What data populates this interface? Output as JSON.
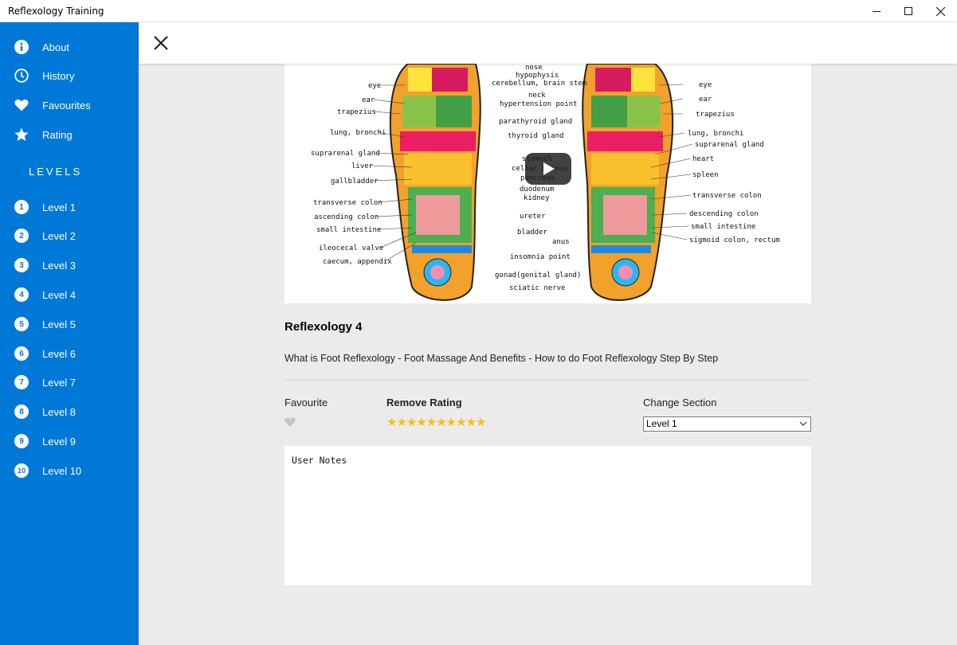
{
  "window": {
    "title": "Reflexology Training"
  },
  "sidebar": {
    "items": [
      {
        "label": "About",
        "icon": "info-icon"
      },
      {
        "label": "History",
        "icon": "clock-icon"
      },
      {
        "label": "Favourites",
        "icon": "heart-icon"
      },
      {
        "label": "Rating",
        "icon": "star-icon"
      }
    ],
    "levels_heading": "LEVELS",
    "levels": [
      {
        "num": "1",
        "label": "Level 1"
      },
      {
        "num": "2",
        "label": "Level 2"
      },
      {
        "num": "3",
        "label": "Level 3"
      },
      {
        "num": "4",
        "label": "Level 4"
      },
      {
        "num": "5",
        "label": "Level 5"
      },
      {
        "num": "6",
        "label": "Level 6"
      },
      {
        "num": "7",
        "label": "Level 7"
      },
      {
        "num": "8",
        "label": "Level 8"
      },
      {
        "num": "9",
        "label": "Level 9"
      },
      {
        "num": "10",
        "label": "Level 10"
      }
    ]
  },
  "video": {
    "diagram_labels_left": [
      "eye",
      "ear",
      "trapezius",
      "lung, bronchi",
      "suprarenal gland",
      "liver",
      "gallbladder",
      "transverse colon",
      "ascending colon",
      "small intestine",
      "ileocecal valve",
      "caecum, appendix"
    ],
    "diagram_labels_center": [
      "nose",
      "hypophysis",
      "cerebellum, brain stem",
      "neck",
      "hypertension point",
      "parathyroid gland",
      "thyroid gland",
      "stomach",
      "celiac plexus",
      "pancreas",
      "duodenum",
      "kidney",
      "ureter",
      "bladder",
      "anus",
      "insomnia point",
      "gonad(genital gland)",
      "sciatic nerve"
    ],
    "diagram_labels_right": [
      "eye",
      "ear",
      "trapezius",
      "lung, bronchi",
      "suprarenal gland",
      "heart",
      "spleen",
      "transverse colon",
      "descending colon",
      "small intestine",
      "sigmoid colon, rectum"
    ],
    "title": "Reflexology 4",
    "description": "What is Foot Reflexology - Foot Massage And Benefits - How to do Foot Reflexology Step By Step"
  },
  "controls": {
    "favourite_label": "Favourite",
    "rating_label": "Remove Rating",
    "rating_stars": "★★★★★★★★★★",
    "section_label": "Change Section",
    "section_selected": "Level 1"
  },
  "notes": {
    "value": "User Notes"
  },
  "colors": {
    "sidebar": "#0078d7",
    "star": "#f4c20d"
  }
}
